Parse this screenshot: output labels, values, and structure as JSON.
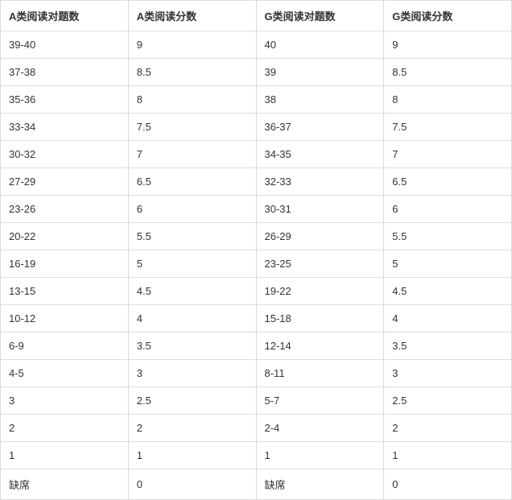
{
  "chart_data": {
    "type": "table",
    "headers": [
      "A类阅读对题数",
      "A类阅读分数",
      "G类阅读对题数",
      "G类阅读分数"
    ],
    "rows": [
      [
        "39-40",
        "9",
        "40",
        "9"
      ],
      [
        "37-38",
        "8.5",
        "39",
        "8.5"
      ],
      [
        "35-36",
        "8",
        "38",
        "8"
      ],
      [
        "33-34",
        "7.5",
        "36-37",
        "7.5"
      ],
      [
        "30-32",
        "7",
        "34-35",
        "7"
      ],
      [
        "27-29",
        "6.5",
        "32-33",
        "6.5"
      ],
      [
        "23-26",
        "6",
        "30-31",
        "6"
      ],
      [
        "20-22",
        "5.5",
        "26-29",
        "5.5"
      ],
      [
        "16-19",
        "5",
        "23-25",
        "5"
      ],
      [
        "13-15",
        "4.5",
        "19-22",
        "4.5"
      ],
      [
        "10-12",
        "4",
        "15-18",
        "4"
      ],
      [
        "6-9",
        "3.5",
        "12-14",
        "3.5"
      ],
      [
        "4-5",
        "3",
        "8-11",
        "3"
      ],
      [
        "3",
        "2.5",
        "5-7",
        "2.5"
      ],
      [
        "2",
        "2",
        "2-4",
        "2"
      ],
      [
        "1",
        "1",
        "1",
        "1"
      ],
      [
        "缺席",
        "0",
        "缺席",
        "0"
      ]
    ]
  }
}
